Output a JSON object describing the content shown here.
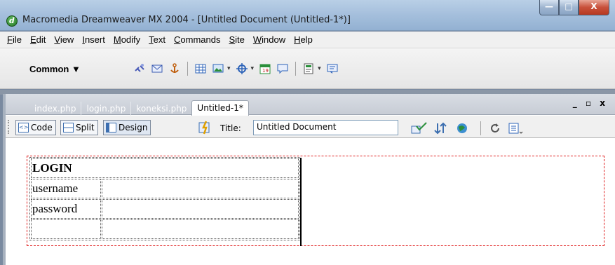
{
  "window": {
    "title": "Macromedia Dreamweaver MX 2004 - [Untitled Document (Untitled-1*)]",
    "app_icon": "d",
    "controls": {
      "minimize": "—",
      "maximize": "□",
      "close": "X"
    }
  },
  "menubar": {
    "items": [
      {
        "u": "F",
        "rest": "ile"
      },
      {
        "u": "E",
        "rest": "dit"
      },
      {
        "u": "V",
        "rest": "iew"
      },
      {
        "u": "I",
        "rest": "nsert"
      },
      {
        "u": "M",
        "rest": "odify"
      },
      {
        "u": "T",
        "rest": "ext"
      },
      {
        "u": "C",
        "rest": "ommands"
      },
      {
        "u": "S",
        "rest": "ite"
      },
      {
        "u": "W",
        "rest": "indow"
      },
      {
        "u": "H",
        "rest": "elp"
      }
    ]
  },
  "insert_toolbar": {
    "category": "Common ▼",
    "icons": [
      "hyperlink-icon",
      "email-link-icon",
      "named-anchor-icon",
      "table-icon",
      "image-icon",
      "media-icon",
      "date-icon",
      "comment-icon",
      "templates-icon",
      "tag-chooser-icon"
    ]
  },
  "document": {
    "tabs": [
      "index.php",
      "login.php",
      "koneksi.php",
      "Untitled-1*"
    ],
    "active_tab": "Untitled-1*",
    "window_controls": "_ ▫ x",
    "views": [
      "Code",
      "Split",
      "Design"
    ],
    "active_view": "Design",
    "title_label": "Title:",
    "title_value": "Untitled Document"
  },
  "form_table": {
    "header": "LOGIN",
    "rows": [
      {
        "label": "username",
        "value": ""
      },
      {
        "label": "password",
        "value": ""
      },
      {
        "label": "",
        "value": ""
      }
    ]
  },
  "colors": {
    "accent": "#3d6fb0",
    "layout_border": "#e02020"
  }
}
